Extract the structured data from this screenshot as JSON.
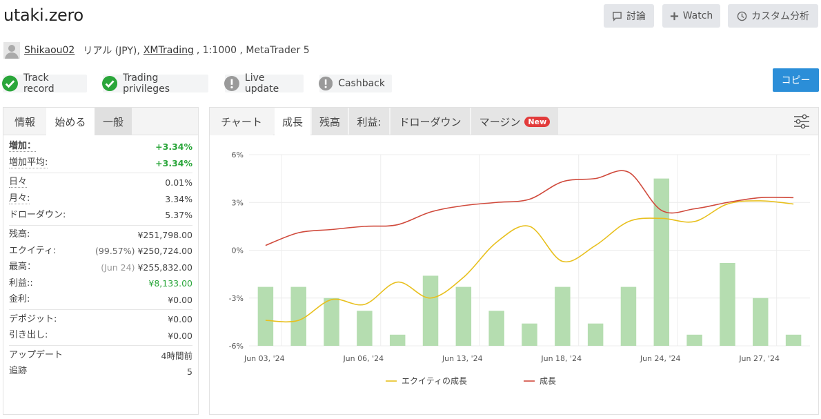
{
  "header": {
    "title": "utaki.zero",
    "discuss_label": "討論",
    "watch_label": "Watch",
    "custom_label": "カスタム分析"
  },
  "account": {
    "owner": "Shikaou02",
    "type": "リアル (JPY),",
    "broker": "XMTrading",
    "details": ", 1:1000 , MetaTrader 5"
  },
  "badges": [
    {
      "label": "Track record",
      "status": "ok"
    },
    {
      "label": "Trading privileges",
      "status": "ok"
    },
    {
      "label": "Live update",
      "status": "warn"
    },
    {
      "label": "Cashback",
      "status": "warn"
    }
  ],
  "copy_label": "コピー",
  "colors": {
    "green": "#2aa63a",
    "gray": "#9a9a9a",
    "blue": "#2b8ed8",
    "equity": "#e8c01e",
    "growth": "#d04a3c",
    "bar": "#b5ddb0"
  },
  "left_tabs": [
    "情報",
    "始める",
    "一般"
  ],
  "stats": {
    "gain_label": "増加：",
    "gain_value": "+3.34%",
    "avg_gain_label": "増加平均:",
    "avg_gain_value": "+3.34%",
    "daily_label": "日々",
    "daily_value": "0.01%",
    "monthly_label": "月々:",
    "monthly_value": "3.34%",
    "drawdown_label": "ドローダウン:",
    "drawdown_value": "5.37%",
    "balance_label": "残高:",
    "balance_value": "¥251,798.00",
    "equity_label": "エクイティ:",
    "equity_pct": "(99.57%)",
    "equity_value": "¥250,724.00",
    "highest_label": "最高：",
    "highest_date": "(Jun 24)",
    "highest_value": "¥255,832.00",
    "profit_label": "利益::",
    "profit_value": "¥8,133.00",
    "interest_label": "金利:",
    "interest_value": "¥0.00",
    "deposits_label": "デポジット:",
    "deposits_value": "¥0.00",
    "withdrawals_label": "引き出し:",
    "withdrawals_value": "¥0.00",
    "updated_label": "アップデート",
    "updated_value": "4時間前",
    "tracking_label": "追跡",
    "tracking_value": "5"
  },
  "right_tabs": [
    "チャート",
    "成長",
    "残高",
    "利益:",
    "ドローダウン",
    "マージン"
  ],
  "new_badge": "New",
  "chart_data": {
    "type": "line",
    "ylim": [
      -6,
      6
    ],
    "yticks": [
      "6%",
      "3%",
      "0%",
      "-3%",
      "-6%"
    ],
    "xticks": [
      "Jun 03, '24",
      "Jun 06, '24",
      "Jun 13, '24",
      "Jun 18, '24",
      "Jun 24, '24",
      "Jun 27, '24"
    ],
    "series": [
      {
        "name": "エクイティの成長",
        "kind": "line",
        "values": [
          -4.4,
          -4.4,
          -3.1,
          -3.4,
          -2.0,
          -3.0,
          -1.7,
          0.5,
          1.5,
          -0.7,
          0.3,
          1.8,
          2.0,
          1.8,
          2.9,
          3.1,
          2.9
        ]
      },
      {
        "name": "成長",
        "kind": "line",
        "values": [
          0.3,
          1.1,
          1.3,
          1.5,
          1.6,
          2.4,
          2.8,
          3.0,
          3.2,
          4.3,
          4.5,
          4.9,
          2.5,
          2.6,
          3.0,
          3.3,
          3.3
        ]
      },
      {
        "name": "daily",
        "kind": "bar",
        "values": [
          -2.3,
          -2.3,
          -3.0,
          -3.8,
          -5.3,
          -1.6,
          -2.3,
          -3.8,
          -4.6,
          -2.3,
          -4.6,
          -2.3,
          4.5,
          -5.3,
          -0.8,
          -3.0,
          -5.3
        ]
      }
    ]
  }
}
